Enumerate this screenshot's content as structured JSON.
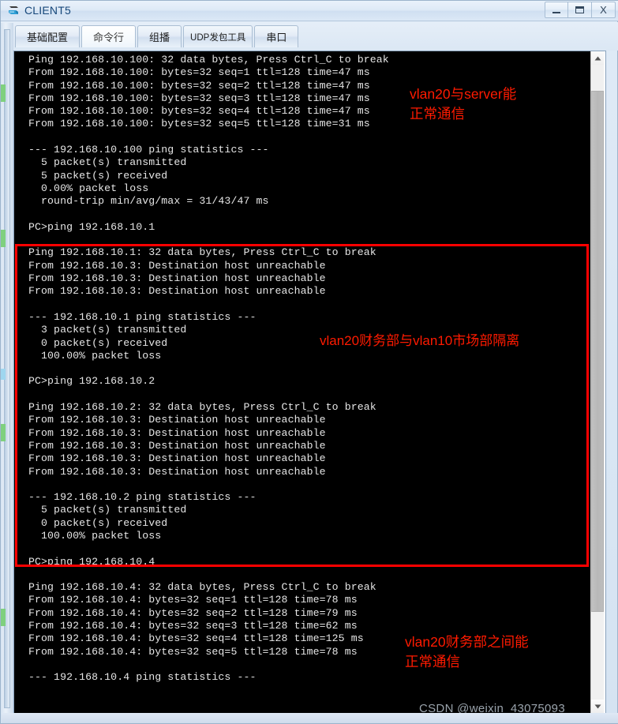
{
  "window": {
    "title": "CLIENT5",
    "icon": "client-pc-icon",
    "controls": {
      "minimize": "minimize-icon",
      "maximize": "maximize-icon",
      "close": "X"
    }
  },
  "tabs": [
    {
      "label": "基础配置",
      "active": false,
      "small": false
    },
    {
      "label": "命令行",
      "active": true,
      "small": false
    },
    {
      "label": "组播",
      "active": false,
      "small": false
    },
    {
      "label": "UDP发包工具",
      "active": false,
      "small": true
    },
    {
      "label": "串口",
      "active": false,
      "small": false
    }
  ],
  "terminal": {
    "lines": [
      "Ping 192.168.10.100: 32 data bytes, Press Ctrl_C to break",
      "From 192.168.10.100: bytes=32 seq=1 ttl=128 time=47 ms",
      "From 192.168.10.100: bytes=32 seq=2 ttl=128 time=47 ms",
      "From 192.168.10.100: bytes=32 seq=3 ttl=128 time=47 ms",
      "From 192.168.10.100: bytes=32 seq=4 ttl=128 time=47 ms",
      "From 192.168.10.100: bytes=32 seq=5 ttl=128 time=31 ms",
      "",
      "--- 192.168.10.100 ping statistics ---",
      "  5 packet(s) transmitted",
      "  5 packet(s) received",
      "  0.00% packet loss",
      "  round-trip min/avg/max = 31/43/47 ms",
      "",
      "PC>ping 192.168.10.1",
      "",
      "Ping 192.168.10.1: 32 data bytes, Press Ctrl_C to break",
      "From 192.168.10.3: Destination host unreachable",
      "From 192.168.10.3: Destination host unreachable",
      "From 192.168.10.3: Destination host unreachable",
      "",
      "--- 192.168.10.1 ping statistics ---",
      "  3 packet(s) transmitted",
      "  0 packet(s) received",
      "  100.00% packet loss",
      "",
      "PC>ping 192.168.10.2",
      "",
      "Ping 192.168.10.2: 32 data bytes, Press Ctrl_C to break",
      "From 192.168.10.3: Destination host unreachable",
      "From 192.168.10.3: Destination host unreachable",
      "From 192.168.10.3: Destination host unreachable",
      "From 192.168.10.3: Destination host unreachable",
      "From 192.168.10.3: Destination host unreachable",
      "",
      "--- 192.168.10.2 ping statistics ---",
      "  5 packet(s) transmitted",
      "  0 packet(s) received",
      "  100.00% packet loss",
      "",
      "PC>ping 192.168.10.4",
      "",
      "Ping 192.168.10.4: 32 data bytes, Press Ctrl_C to break",
      "From 192.168.10.4: bytes=32 seq=1 ttl=128 time=78 ms",
      "From 192.168.10.4: bytes=32 seq=2 ttl=128 time=79 ms",
      "From 192.168.10.4: bytes=32 seq=3 ttl=128 time=62 ms",
      "From 192.168.10.4: bytes=32 seq=4 ttl=128 time=125 ms",
      "From 192.168.10.4: bytes=32 seq=5 ttl=128 time=78 ms",
      "",
      "--- 192.168.10.4 ping statistics ---"
    ]
  },
  "annotations": {
    "top": "vlan20与server能\n正常通信",
    "middle": "vlan20财务部与vlan10市场部隔离",
    "bottom": "vlan20财务部之间能\n正常通信",
    "color": "#ff1a00"
  },
  "watermark": "CSDN @weixin_43075093",
  "scrollbar": {
    "up_arrow": "▲",
    "down_arrow": "▼"
  }
}
